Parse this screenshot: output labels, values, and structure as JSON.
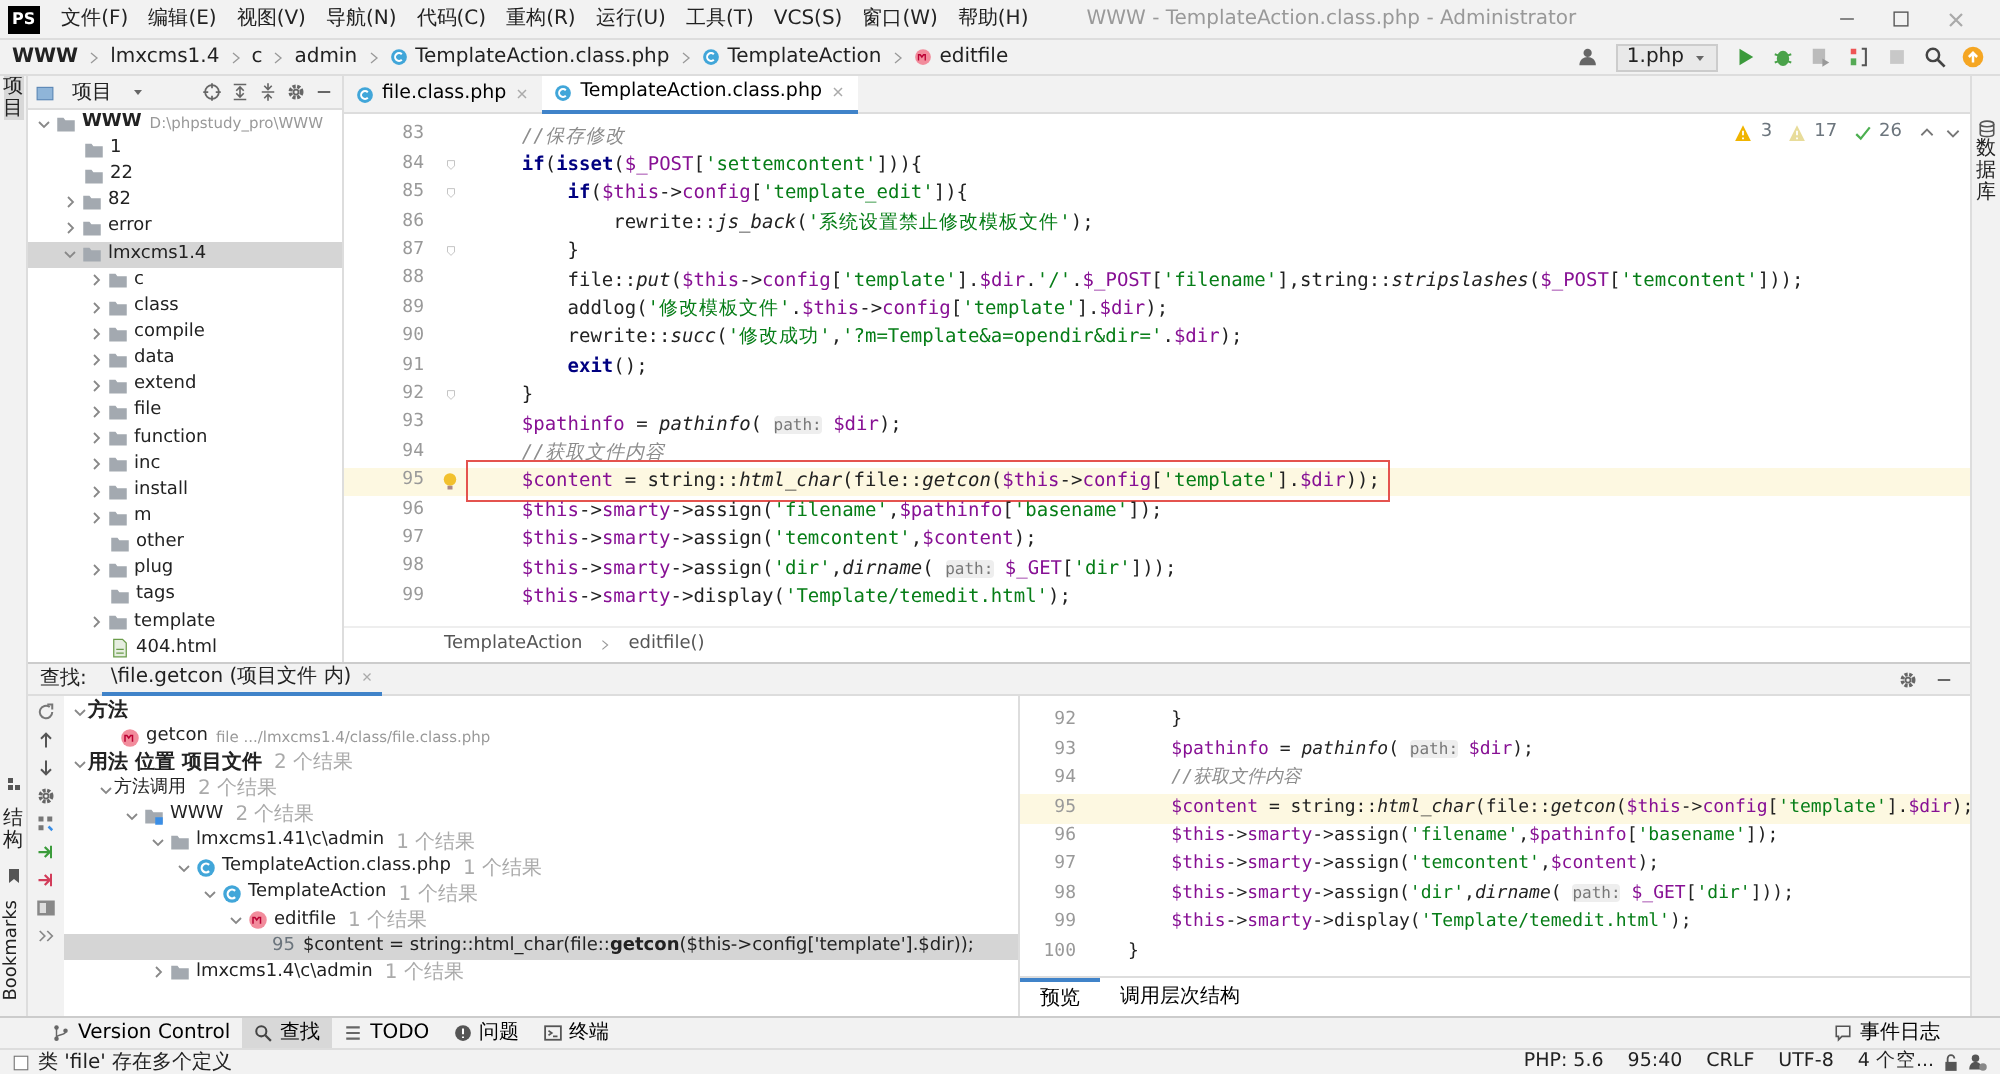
{
  "window": {
    "logo": "PS",
    "title": "WWW - TemplateAction.class.php - Administrator",
    "menu": [
      "文件(F)",
      "编辑(E)",
      "视图(V)",
      "导航(N)",
      "代码(C)",
      "重构(R)",
      "运行(U)",
      "工具(T)",
      "VCS(S)",
      "窗口(W)",
      "帮助(H)"
    ]
  },
  "navbar": {
    "breadcrumbs": [
      {
        "label": "WWW",
        "kind": "root"
      },
      {
        "label": "lmxcms1.4",
        "kind": "plain"
      },
      {
        "label": "c",
        "kind": "plain"
      },
      {
        "label": "admin",
        "kind": "plain"
      },
      {
        "label": "TemplateAction.class.php",
        "kind": "class"
      },
      {
        "label": "TemplateAction",
        "kind": "class"
      },
      {
        "label": "editfile",
        "kind": "method"
      }
    ],
    "run_config": "1.php"
  },
  "stripes": {
    "left_top": "项目",
    "left_bottom": [
      "结构",
      "Bookmarks"
    ],
    "right": "数据库"
  },
  "project": {
    "title": "项目",
    "tree": [
      {
        "label": "WWW",
        "hint": "D:\\phpstudy_pro\\WWW",
        "kind": "root",
        "expanded": true,
        "selected": false,
        "children": [
          {
            "label": "1",
            "kind": "folder",
            "selected": false
          },
          {
            "label": "22",
            "kind": "folder",
            "selected": false
          },
          {
            "label": "82",
            "kind": "folder",
            "expanded": false,
            "selected": false
          },
          {
            "label": "error",
            "kind": "folder",
            "expanded": false,
            "selected": false
          },
          {
            "label": "lmxcms1.4",
            "kind": "folder",
            "expanded": true,
            "selected": true,
            "children": [
              {
                "label": "c",
                "kind": "folder",
                "expanded": false,
                "selected": false
              },
              {
                "label": "class",
                "kind": "folder",
                "expanded": false,
                "selected": false
              },
              {
                "label": "compile",
                "kind": "folder",
                "expanded": false,
                "selected": false
              },
              {
                "label": "data",
                "kind": "folder",
                "expanded": false,
                "selected": false
              },
              {
                "label": "extend",
                "kind": "folder",
                "expanded": false,
                "selected": false
              },
              {
                "label": "file",
                "kind": "folder",
                "expanded": false,
                "selected": false
              },
              {
                "label": "function",
                "kind": "folder",
                "expanded": false,
                "selected": false
              },
              {
                "label": "inc",
                "kind": "folder",
                "expanded": false,
                "selected": false
              },
              {
                "label": "install",
                "kind": "folder",
                "expanded": false,
                "selected": false
              },
              {
                "label": "m",
                "kind": "folder",
                "expanded": false,
                "selected": false
              },
              {
                "label": "other",
                "kind": "folder",
                "selected": false
              },
              {
                "label": "plug",
                "kind": "folder",
                "expanded": false,
                "selected": false
              },
              {
                "label": "tags",
                "kind": "folder",
                "selected": false
              },
              {
                "label": "template",
                "kind": "folder",
                "expanded": false,
                "selected": false
              },
              {
                "label": "404.html",
                "kind": "html",
                "selected": false
              }
            ]
          }
        ]
      }
    ]
  },
  "editor": {
    "tabs": [
      {
        "label": "file.class.php",
        "selected": false
      },
      {
        "label": "TemplateAction.class.php",
        "selected": true
      }
    ],
    "inspections": [
      {
        "kind": "warning",
        "count": "3"
      },
      {
        "kind": "weak",
        "count": "17"
      },
      {
        "kind": "ok",
        "count": "26"
      }
    ],
    "lines": [
      {
        "n": "83",
        "caret": false,
        "boxed": false,
        "bulb": false,
        "fold": false,
        "seg": [
          {
            "kind": "comment",
            "text": "    //保存修改"
          }
        ]
      },
      {
        "n": "84",
        "caret": false,
        "boxed": false,
        "bulb": false,
        "fold": true,
        "seg": [
          {
            "kind": "keyword",
            "text": "    if"
          },
          {
            "kind": "plain",
            "text": "("
          },
          {
            "kind": "keyword",
            "text": "isset"
          },
          {
            "kind": "plain",
            "text": "("
          },
          {
            "kind": "var",
            "text": "$_POST"
          },
          {
            "kind": "plain",
            "text": "["
          },
          {
            "kind": "str",
            "text": "'settemcontent'"
          },
          {
            "kind": "plain",
            "text": "])){"
          }
        ]
      },
      {
        "n": "85",
        "caret": false,
        "boxed": false,
        "bulb": false,
        "fold": true,
        "seg": [
          {
            "kind": "keyword",
            "text": "        if"
          },
          {
            "kind": "plain",
            "text": "("
          },
          {
            "kind": "var",
            "text": "$this"
          },
          {
            "kind": "plain",
            "text": "->"
          },
          {
            "kind": "var",
            "text": "config"
          },
          {
            "kind": "plain",
            "text": "["
          },
          {
            "kind": "str",
            "text": "'template_edit'"
          },
          {
            "kind": "plain",
            "text": "]){"
          }
        ]
      },
      {
        "n": "86",
        "caret": false,
        "boxed": false,
        "bulb": false,
        "fold": false,
        "seg": [
          {
            "kind": "plain",
            "text": "            rewrite::"
          },
          {
            "kind": "fn",
            "text": "js_back"
          },
          {
            "kind": "plain",
            "text": "("
          },
          {
            "kind": "str",
            "text": "'系统设置禁止修改模板文件'"
          },
          {
            "kind": "plain",
            "text": ");"
          }
        ]
      },
      {
        "n": "87",
        "caret": false,
        "boxed": false,
        "bulb": false,
        "fold": true,
        "seg": [
          {
            "kind": "plain",
            "text": "        }"
          }
        ]
      },
      {
        "n": "88",
        "caret": false,
        "boxed": false,
        "bulb": false,
        "fold": false,
        "seg": [
          {
            "kind": "plain",
            "text": "        file::"
          },
          {
            "kind": "fn",
            "text": "put"
          },
          {
            "kind": "plain",
            "text": "("
          },
          {
            "kind": "var",
            "text": "$this"
          },
          {
            "kind": "plain",
            "text": "->"
          },
          {
            "kind": "var",
            "text": "config"
          },
          {
            "kind": "plain",
            "text": "["
          },
          {
            "kind": "str",
            "text": "'template'"
          },
          {
            "kind": "plain",
            "text": "]."
          },
          {
            "kind": "var",
            "text": "$dir"
          },
          {
            "kind": "plain",
            "text": "."
          },
          {
            "kind": "str",
            "text": "'/'"
          },
          {
            "kind": "plain",
            "text": "."
          },
          {
            "kind": "var",
            "text": "$_POST"
          },
          {
            "kind": "plain",
            "text": "["
          },
          {
            "kind": "str",
            "text": "'filename'"
          },
          {
            "kind": "plain",
            "text": "],string::"
          },
          {
            "kind": "fn",
            "text": "stripslashes"
          },
          {
            "kind": "plain",
            "text": "("
          },
          {
            "kind": "var",
            "text": "$_POST"
          },
          {
            "kind": "plain",
            "text": "["
          },
          {
            "kind": "str",
            "text": "'temcontent'"
          },
          {
            "kind": "plain",
            "text": "]));"
          }
        ]
      },
      {
        "n": "89",
        "caret": false,
        "boxed": false,
        "bulb": false,
        "fold": false,
        "seg": [
          {
            "kind": "plain",
            "text": "        addlog("
          },
          {
            "kind": "str",
            "text": "'修改模板文件'"
          },
          {
            "kind": "plain",
            "text": "."
          },
          {
            "kind": "var",
            "text": "$this"
          },
          {
            "kind": "plain",
            "text": "->"
          },
          {
            "kind": "var",
            "text": "config"
          },
          {
            "kind": "plain",
            "text": "["
          },
          {
            "kind": "str",
            "text": "'template'"
          },
          {
            "kind": "plain",
            "text": "]."
          },
          {
            "kind": "var",
            "text": "$dir"
          },
          {
            "kind": "plain",
            "text": ");"
          }
        ]
      },
      {
        "n": "90",
        "caret": false,
        "boxed": false,
        "bulb": false,
        "fold": false,
        "seg": [
          {
            "kind": "plain",
            "text": "        rewrite::"
          },
          {
            "kind": "fn",
            "text": "succ"
          },
          {
            "kind": "plain",
            "text": "("
          },
          {
            "kind": "str",
            "text": "'修改成功'"
          },
          {
            "kind": "plain",
            "text": ","
          },
          {
            "kind": "str",
            "text": "'?m=Template&a=opendir&dir='"
          },
          {
            "kind": "plain",
            "text": "."
          },
          {
            "kind": "var",
            "text": "$dir"
          },
          {
            "kind": "plain",
            "text": ");"
          }
        ]
      },
      {
        "n": "91",
        "caret": false,
        "boxed": false,
        "bulb": false,
        "fold": false,
        "seg": [
          {
            "kind": "keyword",
            "text": "        exit"
          },
          {
            "kind": "plain",
            "text": "();"
          }
        ]
      },
      {
        "n": "92",
        "caret": false,
        "boxed": false,
        "bulb": false,
        "fold": true,
        "seg": [
          {
            "kind": "plain",
            "text": "    }"
          }
        ]
      },
      {
        "n": "93",
        "caret": false,
        "boxed": false,
        "bulb": false,
        "fold": false,
        "seg": [
          {
            "kind": "var",
            "text": "    $pathinfo"
          },
          {
            "kind": "plain",
            "text": " = "
          },
          {
            "kind": "fn",
            "text": "pathinfo"
          },
          {
            "kind": "plain",
            "text": "( "
          },
          {
            "kind": "hint",
            "text": "path:"
          },
          {
            "kind": "var",
            "text": " $dir"
          },
          {
            "kind": "plain",
            "text": ");"
          }
        ]
      },
      {
        "n": "94",
        "caret": false,
        "boxed": false,
        "bulb": false,
        "fold": false,
        "seg": [
          {
            "kind": "comment",
            "text": "    //获取文件内容"
          }
        ]
      },
      {
        "n": "95",
        "caret": true,
        "boxed": true,
        "bulb": true,
        "fold": false,
        "seg": [
          {
            "kind": "var",
            "text": "    $content"
          },
          {
            "kind": "plain",
            "text": " = string::"
          },
          {
            "kind": "fn",
            "text": "html_char"
          },
          {
            "kind": "plain",
            "text": "(file::"
          },
          {
            "kind": "fn",
            "text": "getcon"
          },
          {
            "kind": "plain",
            "text": "("
          },
          {
            "kind": "var",
            "text": "$this"
          },
          {
            "kind": "plain",
            "text": "->"
          },
          {
            "kind": "var",
            "text": "config"
          },
          {
            "kind": "plain",
            "text": "["
          },
          {
            "kind": "str",
            "text": "'template'"
          },
          {
            "kind": "plain",
            "text": "]."
          },
          {
            "kind": "var",
            "text": "$dir"
          },
          {
            "kind": "plain",
            "text": "));"
          }
        ]
      },
      {
        "n": "96",
        "caret": false,
        "boxed": false,
        "bulb": false,
        "fold": false,
        "seg": [
          {
            "kind": "var",
            "text": "    $this"
          },
          {
            "kind": "plain",
            "text": "->"
          },
          {
            "kind": "var",
            "text": "smarty"
          },
          {
            "kind": "plain",
            "text": "->assign("
          },
          {
            "kind": "str",
            "text": "'filename'"
          },
          {
            "kind": "plain",
            "text": ","
          },
          {
            "kind": "var",
            "text": "$pathinfo"
          },
          {
            "kind": "plain",
            "text": "["
          },
          {
            "kind": "str",
            "text": "'basename'"
          },
          {
            "kind": "plain",
            "text": "]);"
          }
        ]
      },
      {
        "n": "97",
        "caret": false,
        "boxed": false,
        "bulb": false,
        "fold": false,
        "seg": [
          {
            "kind": "var",
            "text": "    $this"
          },
          {
            "kind": "plain",
            "text": "->"
          },
          {
            "kind": "var",
            "text": "smarty"
          },
          {
            "kind": "plain",
            "text": "->assign("
          },
          {
            "kind": "str",
            "text": "'temcontent'"
          },
          {
            "kind": "plain",
            "text": ","
          },
          {
            "kind": "var",
            "text": "$content"
          },
          {
            "kind": "plain",
            "text": ");"
          }
        ]
      },
      {
        "n": "98",
        "caret": false,
        "boxed": false,
        "bulb": false,
        "fold": false,
        "seg": [
          {
            "kind": "var",
            "text": "    $this"
          },
          {
            "kind": "plain",
            "text": "->"
          },
          {
            "kind": "var",
            "text": "smarty"
          },
          {
            "kind": "plain",
            "text": "->assign("
          },
          {
            "kind": "str",
            "text": "'dir'"
          },
          {
            "kind": "plain",
            "text": ","
          },
          {
            "kind": "fn",
            "text": "dirname"
          },
          {
            "kind": "plain",
            "text": "( "
          },
          {
            "kind": "hint",
            "text": "path:"
          },
          {
            "kind": "var",
            "text": " $_GET"
          },
          {
            "kind": "plain",
            "text": "["
          },
          {
            "kind": "str",
            "text": "'dir'"
          },
          {
            "kind": "plain",
            "text": "]));"
          }
        ]
      },
      {
        "n": "99",
        "caret": false,
        "boxed": false,
        "bulb": false,
        "fold": false,
        "seg": [
          {
            "kind": "var",
            "text": "    $this"
          },
          {
            "kind": "plain",
            "text": "->"
          },
          {
            "kind": "var",
            "text": "smarty"
          },
          {
            "kind": "plain",
            "text": "->display("
          },
          {
            "kind": "str",
            "text": "'Template/temedit.html'"
          },
          {
            "kind": "plain",
            "text": ");"
          }
        ]
      }
    ],
    "breadcrumbs": [
      "TemplateAction",
      "editfile()"
    ]
  },
  "find": {
    "label": "查找:",
    "tab": "\\file.getcon (项目文件 内)",
    "results": [
      {
        "label": "方法",
        "kind": "group",
        "expanded": true,
        "selected": false,
        "children": [
          {
            "label": "getcon",
            "kind": "method",
            "hint": "file .../lmxcms1.4/class/file.class.php",
            "selected": false
          }
        ]
      },
      {
        "label": "用法 位置 项目文件",
        "kind": "group",
        "count": "2 个结果",
        "expanded": true,
        "selected": false,
        "children": [
          {
            "label": "方法调用",
            "kind": "calls",
            "count": "2 个结果",
            "expanded": true,
            "selected": false,
            "children": [
              {
                "label": "WWW",
                "kind": "module",
                "count": "2 个结果",
                "expanded": true,
                "selected": false,
                "children": [
                  {
                    "label": "lmxcms1.41\\c\\admin",
                    "kind": "folder",
                    "count": "1 个结果",
                    "expanded": true,
                    "selected": false,
                    "children": [
                      {
                        "label": "TemplateAction.class.php",
                        "kind": "class",
                        "count": "1 个结果",
                        "expanded": true,
                        "selected": false,
                        "children": [
                          {
                            "label": "TemplateAction",
                            "kind": "class",
                            "count": "1 个结果",
                            "expanded": true,
                            "selected": false,
                            "children": [
                              {
                                "label": "editfile",
                                "kind": "method",
                                "count": "1 个结果",
                                "expanded": true,
                                "selected": false,
                                "children": [
                                  {
                                    "line": "95",
                                    "label": "$content = string::html_char(file::**getcon**($this->config['template'].$dir));",
                                    "kind": "usage",
                                    "selected": true
                                  }
                                ]
                              }
                            ]
                          }
                        ]
                      }
                    ]
                  },
                  {
                    "label": "lmxcms1.4\\c\\admin",
                    "kind": "folder",
                    "count": "1 个结果",
                    "expanded": false,
                    "selected": false
                  }
                ]
              }
            ]
          }
        ]
      }
    ],
    "preview": {
      "lines": [
        {
          "n": "92",
          "caret": false,
          "seg": [
            {
              "kind": "plain",
              "text": "    }"
            }
          ]
        },
        {
          "n": "93",
          "caret": false,
          "seg": [
            {
              "kind": "var",
              "text": "    $pathinfo"
            },
            {
              "kind": "plain",
              "text": " = "
            },
            {
              "kind": "fn",
              "text": "pathinfo"
            },
            {
              "kind": "plain",
              "text": "( "
            },
            {
              "kind": "hint",
              "text": "path:"
            },
            {
              "kind": "var",
              "text": " $dir"
            },
            {
              "kind": "plain",
              "text": ");"
            }
          ]
        },
        {
          "n": "94",
          "caret": false,
          "seg": [
            {
              "kind": "comment",
              "text": "    //获取文件内容"
            }
          ]
        },
        {
          "n": "95",
          "caret": true,
          "seg": [
            {
              "kind": "var",
              "text": "    $content"
            },
            {
              "kind": "plain",
              "text": " = string::"
            },
            {
              "kind": "fn",
              "text": "html_char"
            },
            {
              "kind": "plain",
              "text": "(file::"
            },
            {
              "kind": "fn",
              "text": "getcon"
            },
            {
              "kind": "plain",
              "text": "("
            },
            {
              "kind": "var",
              "text": "$this"
            },
            {
              "kind": "plain",
              "text": "->"
            },
            {
              "kind": "var",
              "text": "config"
            },
            {
              "kind": "plain",
              "text": "["
            },
            {
              "kind": "str",
              "text": "'template'"
            },
            {
              "kind": "plain",
              "text": "]."
            },
            {
              "kind": "var",
              "text": "$dir"
            },
            {
              "kind": "plain",
              "text": ");"
            }
          ]
        },
        {
          "n": "96",
          "caret": false,
          "seg": [
            {
              "kind": "var",
              "text": "    $this"
            },
            {
              "kind": "plain",
              "text": "->"
            },
            {
              "kind": "var",
              "text": "smarty"
            },
            {
              "kind": "plain",
              "text": "->assign("
            },
            {
              "kind": "str",
              "text": "'filename'"
            },
            {
              "kind": "plain",
              "text": ","
            },
            {
              "kind": "var",
              "text": "$pathinfo"
            },
            {
              "kind": "plain",
              "text": "["
            },
            {
              "kind": "str",
              "text": "'basename'"
            },
            {
              "kind": "plain",
              "text": "]);"
            }
          ]
        },
        {
          "n": "97",
          "caret": false,
          "seg": [
            {
              "kind": "var",
              "text": "    $this"
            },
            {
              "kind": "plain",
              "text": "->"
            },
            {
              "kind": "var",
              "text": "smarty"
            },
            {
              "kind": "plain",
              "text": "->assign("
            },
            {
              "kind": "str",
              "text": "'temcontent'"
            },
            {
              "kind": "plain",
              "text": ","
            },
            {
              "kind": "var",
              "text": "$content"
            },
            {
              "kind": "plain",
              "text": ");"
            }
          ]
        },
        {
          "n": "98",
          "caret": false,
          "seg": [
            {
              "kind": "var",
              "text": "    $this"
            },
            {
              "kind": "plain",
              "text": "->"
            },
            {
              "kind": "var",
              "text": "smarty"
            },
            {
              "kind": "plain",
              "text": "->assign("
            },
            {
              "kind": "str",
              "text": "'dir'"
            },
            {
              "kind": "plain",
              "text": ","
            },
            {
              "kind": "fn",
              "text": "dirname"
            },
            {
              "kind": "plain",
              "text": "( "
            },
            {
              "kind": "hint",
              "text": "path:"
            },
            {
              "kind": "var",
              "text": " $_GET"
            },
            {
              "kind": "plain",
              "text": "["
            },
            {
              "kind": "str",
              "text": "'dir'"
            },
            {
              "kind": "plain",
              "text": "]));"
            }
          ]
        },
        {
          "n": "99",
          "caret": false,
          "seg": [
            {
              "kind": "var",
              "text": "    $this"
            },
            {
              "kind": "plain",
              "text": "->"
            },
            {
              "kind": "var",
              "text": "smarty"
            },
            {
              "kind": "plain",
              "text": "->display("
            },
            {
              "kind": "str",
              "text": "'Template/temedit.html'"
            },
            {
              "kind": "plain",
              "text": ");"
            }
          ]
        },
        {
          "n": "100",
          "caret": false,
          "seg": [
            {
              "kind": "plain",
              "text": "}"
            }
          ]
        }
      ],
      "tabs": [
        {
          "label": "预览",
          "selected": true
        },
        {
          "label": "调用层次结构",
          "selected": false
        }
      ]
    }
  },
  "tool_tabs": [
    {
      "label": "Version Control",
      "kind": "vcs",
      "selected": false
    },
    {
      "label": "查找",
      "kind": "find",
      "selected": true
    },
    {
      "label": "TODO",
      "kind": "todo",
      "selected": false
    },
    {
      "label": "问题",
      "kind": "problems",
      "selected": false
    },
    {
      "label": "终端",
      "kind": "terminal",
      "selected": false
    }
  ],
  "event_log": "事件日志",
  "status_bar": {
    "message": "类 'file' 存在多个定义",
    "items": [
      "PHP: 5.6",
      "95:40",
      "CRLF",
      "UTF-8",
      "4 个空..."
    ]
  }
}
